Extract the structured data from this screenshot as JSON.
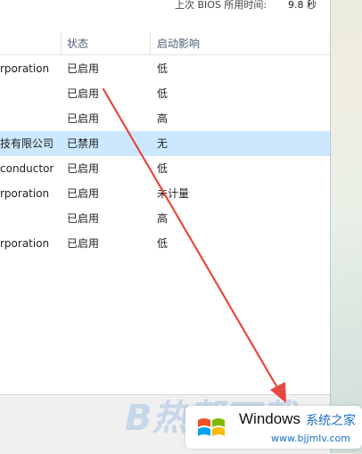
{
  "bios_time": {
    "label": "上次 BIOS 所用时间:",
    "value": "9.8 秒"
  },
  "columns": {
    "status": "状态",
    "impact": "启动影响"
  },
  "rows": [
    {
      "name": "rporation",
      "status": "已启用",
      "impact": "低"
    },
    {
      "name": "",
      "status": "已启用",
      "impact": "低"
    },
    {
      "name": "",
      "status": "已启用",
      "impact": "高"
    },
    {
      "name": "技有限公司",
      "status": "已禁用",
      "impact": "无",
      "selected": true
    },
    {
      "name": "conductor",
      "status": "已启用",
      "impact": "低"
    },
    {
      "name": "rporation",
      "status": "已启用",
      "impact": "未计量"
    },
    {
      "name": "",
      "status": "已启用",
      "impact": "高"
    },
    {
      "name": "rporation",
      "status": "已启用",
      "impact": "低"
    }
  ],
  "annotation": {
    "arrow_color": "#e8473f"
  },
  "watermark": {
    "overlay": "B热帮下载",
    "brand": "Windows",
    "subtitle": "系统之家",
    "url": "www.bjjmlv.com"
  }
}
